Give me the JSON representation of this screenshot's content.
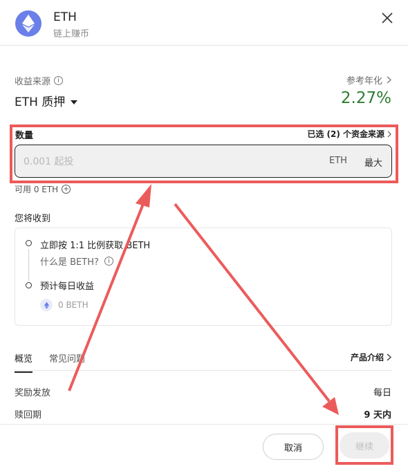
{
  "header": {
    "title": "ETH",
    "subtitle": "链上赚币",
    "coin_icon": "ethereum-icon",
    "close_icon": "close-icon"
  },
  "source": {
    "label": "收益来源",
    "value": "ETH 质押",
    "apr_label": "参考年化",
    "apr_value": "2.27%",
    "apr_color": "#2e7d32"
  },
  "amount": {
    "label": "数量",
    "selected_sources": "已选 (2) 个资金来源",
    "placeholder": "0.001 起投",
    "unit": "ETH",
    "max_label": "最大",
    "available": "可用 0 ETH"
  },
  "receive": {
    "title": "您将收到",
    "line1": "立即按 1:1 比例获取 BETH",
    "line2": "什么是 BETH?",
    "line3": "预计每日收益",
    "beth_amount": "0 BETH"
  },
  "tabs": {
    "items": [
      {
        "label": "概览",
        "active": true
      },
      {
        "label": "常见问题",
        "active": false
      }
    ],
    "product_intro": "产品介绍"
  },
  "details": [
    {
      "label": "奖励发放",
      "value": "每日"
    },
    {
      "label": "赎回期",
      "value": "9 天内"
    }
  ],
  "footer": {
    "cancel_label": "取消",
    "continue_label": "继续"
  },
  "annotation_color": "#ec5b5b"
}
